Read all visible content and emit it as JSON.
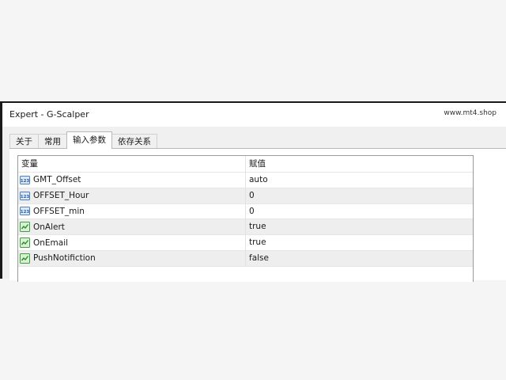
{
  "window": {
    "title": "Expert - G-Scalper",
    "watermark": "www.mt4.shop"
  },
  "tabs": [
    {
      "label": "关于",
      "active": false
    },
    {
      "label": "常用",
      "active": false
    },
    {
      "label": "输入参数",
      "active": true
    },
    {
      "label": "依存关系",
      "active": false
    }
  ],
  "grid": {
    "headers": {
      "name": "变量",
      "value": "赋值"
    },
    "rows": [
      {
        "name": "GMT_Offset",
        "value": "auto",
        "icon": "numeric-param-icon"
      },
      {
        "name": "OFFSET_Hour",
        "value": "0",
        "icon": "numeric-param-icon"
      },
      {
        "name": "OFFSET_min",
        "value": "0",
        "icon": "numeric-param-icon"
      },
      {
        "name": "OnAlert",
        "value": "true",
        "icon": "boolean-param-icon"
      },
      {
        "name": "OnEmail",
        "value": "true",
        "icon": "boolean-param-icon"
      },
      {
        "name": "PushNotifiction",
        "value": "false",
        "icon": "boolean-param-icon"
      }
    ]
  },
  "colors": {
    "numeric_icon": "#4a7fc1",
    "boolean_icon": "#3ba03b",
    "row_alt": "#eeeeee"
  }
}
